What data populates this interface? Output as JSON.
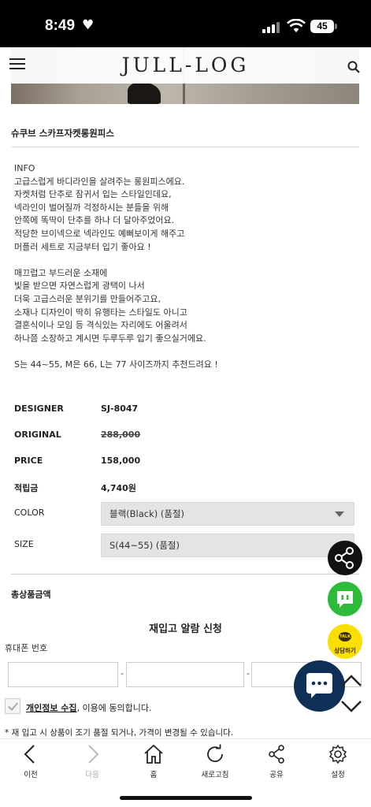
{
  "status_bar": {
    "time": "8:49",
    "battery": "45"
  },
  "header": {
    "logo": "JULL-LOG"
  },
  "product": {
    "title": "슈쿠브 스카프자켓롱원피스",
    "description": "INFO\n고급스럽게 바디라인을 살려주는 롱원피스에요.\n자켓처럼 단추로 잠귀서 입는 스타일인데요,\n넥라인이 벌어질까 걱정하시는 분들을 위해\n안쪽에 똑딱이 단추를 하나 더 달아주었어요.\n적당한 브이넥으로 넥라인도 예뻐보이게 해주고\n머플러 세트로 지금부터 입기 좋아요 !\n\n매끄럽고 부드러운 소재에\n빛을 받으면 자연스럽게 광택이 나서\n더욱 고급스러운 분위기를 만들어주고요,\n소재나 디자인이 딱히 유행타는 스타일도 아니고\n결혼식이나 모임 등 격식있는 자리에도 어울려서\n하나쯤 소장하고 계시면 두루두루 입기 좋으실거에요.\n\nS는 44~55, M은 66, L는 77 사이즈까지 추천드려요 !",
    "specs": {
      "designer_label": "DESIGNER",
      "designer_value": "SJ-8047",
      "original_label": "ORIGINAL",
      "original_value": "288,000",
      "price_label": "PRICE",
      "price_value": "158,000",
      "points_label": "적립금",
      "points_value": "4,740원"
    },
    "options": {
      "color_label": "COLOR",
      "color_value": "블랙(Black) (품절)",
      "size_label": "SIZE",
      "size_value": "S(44~55) (품절)"
    },
    "total_label": "총상품금액"
  },
  "restock": {
    "title": "재입고 알람 신청",
    "phone_label": "휴대폰 번호",
    "dash": "-",
    "agree_link": "개인정보 수집",
    "agree_text": ", 이용에 동의합니다.",
    "notice": "* 재 입고 시 상품이 조기 품절 되거나, 가격이 변경될 수 있습니다."
  },
  "floating": {
    "kakao_label": "상담하기",
    "kakao_bubble": "TALK"
  },
  "bottom_nav": {
    "back": "이전",
    "forward": "다음",
    "home": "홈",
    "refresh": "새로고침",
    "share": "공유",
    "settings": "설정"
  }
}
